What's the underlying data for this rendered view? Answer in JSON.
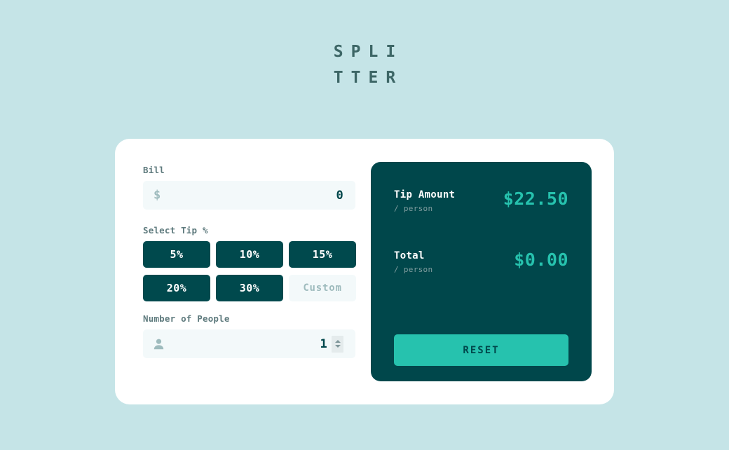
{
  "app": {
    "logo_line_1": "SPLI",
    "logo_line_2": "TTER"
  },
  "colors": {
    "page_background": "#C5E4E7",
    "card_background": "#FFFFFF",
    "panel_background": "#00474B",
    "tip_button": "#00494D",
    "accent": "#26C2AE",
    "input_background": "#F3F9FA",
    "label_text": "#5E7A7D",
    "muted_text": "#9EBBBD"
  },
  "form": {
    "bill": {
      "label": "Bill",
      "icon": "dollar-icon",
      "value": "0",
      "placeholder": "0"
    },
    "tip": {
      "label": "Select Tip %",
      "options": [
        {
          "label": "5%",
          "value": 5,
          "selected": false
        },
        {
          "label": "10%",
          "value": 10,
          "selected": false
        },
        {
          "label": "15%",
          "value": 15,
          "selected": false
        },
        {
          "label": "20%",
          "value": 20,
          "selected": false
        },
        {
          "label": "30%",
          "value": 30,
          "selected": false
        }
      ],
      "custom_placeholder": "Custom"
    },
    "people": {
      "label": "Number of People",
      "icon": "person-icon",
      "value": "1",
      "placeholder": "1"
    }
  },
  "results": {
    "rows": [
      {
        "label": "Tip Amount",
        "sublabel": "/ person",
        "value": "$22.50"
      },
      {
        "label": "Total",
        "sublabel": "/ person",
        "value": "$0.00"
      }
    ],
    "reset_label": "RESET"
  }
}
